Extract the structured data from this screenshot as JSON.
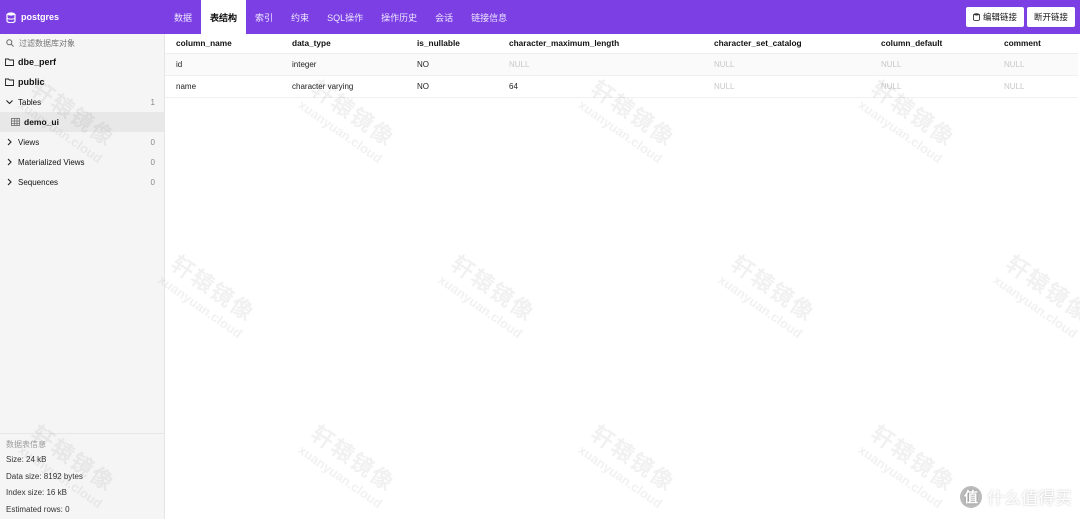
{
  "brand": {
    "title": "postgres",
    "icon": "database-icon"
  },
  "tabs": [
    {
      "label": "数据",
      "active": false
    },
    {
      "label": "表结构",
      "active": true
    },
    {
      "label": "索引",
      "active": false
    },
    {
      "label": "约束",
      "active": false
    },
    {
      "label": "SQL操作",
      "active": false
    },
    {
      "label": "操作历史",
      "active": false
    },
    {
      "label": "会话",
      "active": false
    },
    {
      "label": "链接信息",
      "active": false
    }
  ],
  "actions": {
    "edit_label": "编辑链接",
    "disconnect_label": "断开链接"
  },
  "sidebar": {
    "search_placeholder": "过滤数据库对象",
    "databases": [
      "dbe_perf",
      "public"
    ],
    "tables_label": "Tables",
    "tables_count": "1",
    "table_item": "demo_ui",
    "views_label": "Views",
    "views_count": "0",
    "mviews_label": "Materialized Views",
    "mviews_count": "0",
    "sequences_label": "Sequences",
    "sequences_count": "0"
  },
  "info": {
    "title": "数据表信息",
    "size": "Size: 24 kB",
    "data_size": "Data size: 8192 bytes",
    "index_size": "Index size: 16 kB",
    "estimated_rows": "Estimated rows: 0"
  },
  "table": {
    "columns": [
      "column_name",
      "data_type",
      "is_nullable",
      "character_maximum_length",
      "character_set_catalog",
      "column_default",
      "comment"
    ],
    "rows": [
      [
        "id",
        "integer",
        "NO",
        "NULL",
        "NULL",
        "NULL",
        "NULL"
      ],
      [
        "name",
        "character varying",
        "NO",
        "64",
        "NULL",
        "NULL",
        "NULL"
      ]
    ]
  },
  "watermark": {
    "cn": "轩辕镜像",
    "en": "xuanyuan.cloud"
  },
  "corner_badge": {
    "glyph": "值",
    "text": "什么值得买"
  },
  "colors": {
    "accent": "#7b3fe4",
    "null_text": "#c8c8c8"
  }
}
